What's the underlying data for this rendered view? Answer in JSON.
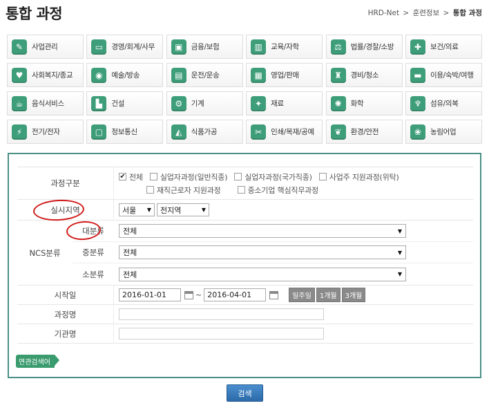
{
  "header": {
    "title": "통합 과정",
    "breadcrumb": [
      "HRD-Net",
      "훈련정보",
      "통합 과정"
    ],
    "breadcrumb_sep": ">"
  },
  "categories": [
    {
      "label": "사업관리",
      "icon": "lightbulb-icon",
      "glyph": "✎"
    },
    {
      "label": "경영/회계/사무",
      "icon": "monitor-icon",
      "glyph": "▭"
    },
    {
      "label": "금융/보험",
      "icon": "briefcase-icon",
      "glyph": "▣"
    },
    {
      "label": "교육/자학",
      "icon": "books-icon",
      "glyph": "▥"
    },
    {
      "label": "법률/경찰/소방",
      "icon": "gavel-icon",
      "glyph": "⚖"
    },
    {
      "label": "보건/의료",
      "icon": "syringe-icon",
      "glyph": "✚"
    },
    {
      "label": "사회복지/종교",
      "icon": "heart-icon",
      "glyph": "♥"
    },
    {
      "label": "예술/방송",
      "icon": "camera-icon",
      "glyph": "◉"
    },
    {
      "label": "운전/운송",
      "icon": "bus-icon",
      "glyph": "▤"
    },
    {
      "label": "영업/판매",
      "icon": "shopping-bag-icon",
      "glyph": "▦"
    },
    {
      "label": "경비/청소",
      "icon": "mop-icon",
      "glyph": "♜"
    },
    {
      "label": "이용/숙박/여행",
      "icon": "bed-icon",
      "glyph": "▬"
    },
    {
      "label": "음식서비스",
      "icon": "cup-icon",
      "glyph": "☕"
    },
    {
      "label": "건설",
      "icon": "building-icon",
      "glyph": "▙"
    },
    {
      "label": "기계",
      "icon": "gears-icon",
      "glyph": "⚙"
    },
    {
      "label": "재료",
      "icon": "wand-icon",
      "glyph": "✦"
    },
    {
      "label": "화학",
      "icon": "atom-icon",
      "glyph": "✺"
    },
    {
      "label": "섬유/의복",
      "icon": "hanger-icon",
      "glyph": "♆"
    },
    {
      "label": "전기/전자",
      "icon": "lightning-icon",
      "glyph": "⚡"
    },
    {
      "label": "정보통신",
      "icon": "computer-icon",
      "glyph": "▢"
    },
    {
      "label": "식품가공",
      "icon": "mixer-icon",
      "glyph": "◭"
    },
    {
      "label": "인쇄/목재/공예",
      "icon": "tools-icon",
      "glyph": "✂"
    },
    {
      "label": "환경/안전",
      "icon": "leaf-icon",
      "glyph": "❦"
    },
    {
      "label": "농림어업",
      "icon": "harvest-icon",
      "glyph": "❀"
    }
  ],
  "form": {
    "course_type": {
      "label": "과정구분",
      "options": [
        {
          "label": "전체",
          "checked": true
        },
        {
          "label": "실업자과정(일반직종)",
          "checked": false
        },
        {
          "label": "실업자과정(국가직종)",
          "checked": false
        },
        {
          "label": "사업주 지원과정(위탁)",
          "checked": false
        },
        {
          "label": "재직근로자 지원과정",
          "checked": false
        },
        {
          "label": "중소기업 핵심직무과정",
          "checked": false
        }
      ]
    },
    "region": {
      "label": "실시지역",
      "province": "서울",
      "district": "전지역"
    },
    "ncs": {
      "label": "NCS분류",
      "major": {
        "label": "대분류",
        "value": "전체"
      },
      "middle": {
        "label": "중분류",
        "value": "전체"
      },
      "minor": {
        "label": "소분류",
        "value": "전체"
      }
    },
    "start_date": {
      "label": "시작일",
      "from": "2016-01-01",
      "tilde": "~",
      "to": "2016-04-01",
      "quick_periods": [
        "일주일",
        "1개월",
        "3개월"
      ]
    },
    "course_name": {
      "label": "과정명",
      "value": ""
    },
    "institution": {
      "label": "기관명",
      "value": ""
    },
    "related_search_label": "연관검색어"
  },
  "search_button": "검색",
  "colors": {
    "category_icon_bg": "#3f9e7a",
    "panel_border": "#4a8f85",
    "search_button": "#3a7bbf",
    "annotation": "#d11a1a"
  }
}
